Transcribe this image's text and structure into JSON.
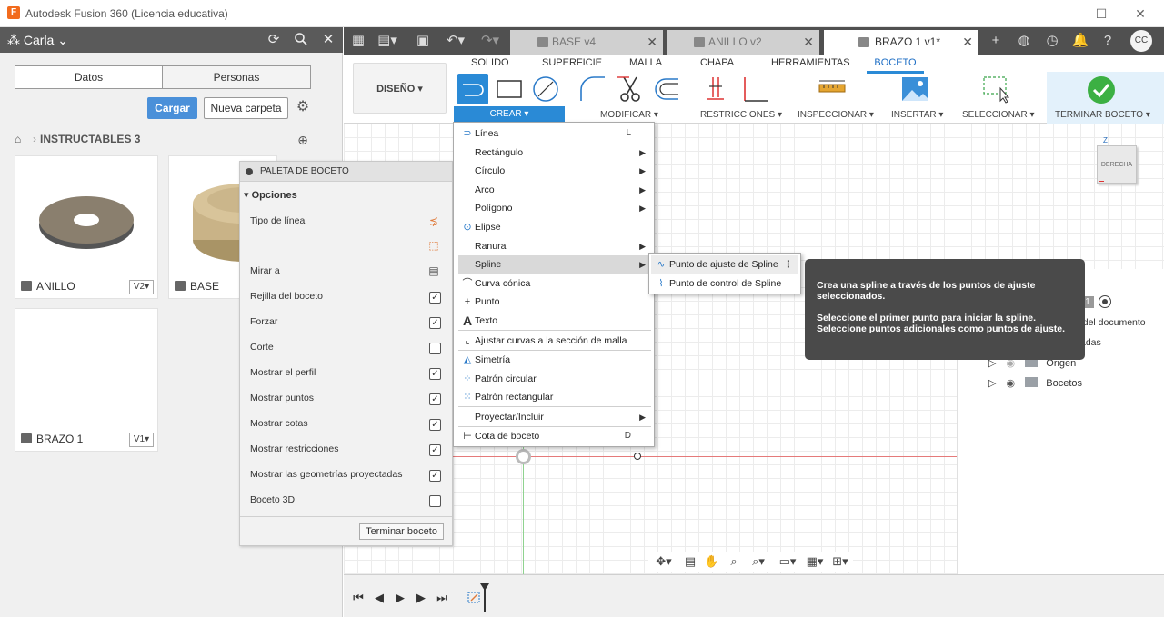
{
  "titlebar": {
    "app_icon": "F",
    "title": "Autodesk Fusion 360 (Licencia educativa)",
    "minimize": "—",
    "maximize": "☐",
    "close": "✕"
  },
  "left_panel": {
    "user": "Carla",
    "tabs": [
      "Datos",
      "Personas"
    ],
    "cargar": "Cargar",
    "nueva_carpeta": "Nueva carpeta",
    "breadcrumb_folder": "INSTRUCTABLES 3",
    "cards": [
      {
        "name": "ANILLO",
        "version": "V2▾"
      },
      {
        "name": "BASE",
        "version": ""
      },
      {
        "name": "BRAZO 1",
        "version": "V1▾"
      }
    ]
  },
  "tabs": [
    {
      "label": "BASE v4"
    },
    {
      "label": "ANILLO v2"
    },
    {
      "label": "BRAZO 1 v1*"
    }
  ],
  "user_badge": "CC",
  "toolbar": {
    "diseno": "DISEÑO ▾",
    "ribbon_tabs": [
      "SOLIDO",
      "SUPERFICIE",
      "MALLA",
      "CHAPA",
      "HERRAMIENTAS",
      "BOCETO"
    ],
    "groups": {
      "crear": "CREAR ▾",
      "modificar": "MODIFICAR ▾",
      "restricciones": "RESTRICCIONES ▾",
      "inspeccionar": "INSPECCIONAR ▾",
      "insertar": "INSERTAR ▾",
      "seleccionar": "SELECCIONAR ▾",
      "terminar": "TERMINAR BOCETO ▾"
    }
  },
  "palette": {
    "title": "PALETA DE BOCETO",
    "section": "▾ Opciones",
    "rows": [
      {
        "label": "Tipo de línea",
        "kind": "icon"
      },
      {
        "label": "",
        "kind": "icon"
      },
      {
        "label": "Mirar a",
        "kind": "icon"
      },
      {
        "label": "Rejilla del boceto",
        "kind": "check",
        "checked": true
      },
      {
        "label": "Forzar",
        "kind": "check",
        "checked": true
      },
      {
        "label": "Corte",
        "kind": "check",
        "checked": false
      },
      {
        "label": "Mostrar el perfil",
        "kind": "check",
        "checked": true
      },
      {
        "label": "Mostrar puntos",
        "kind": "check",
        "checked": true
      },
      {
        "label": "Mostrar cotas",
        "kind": "check",
        "checked": true
      },
      {
        "label": "Mostrar restricciones",
        "kind": "check",
        "checked": true
      },
      {
        "label": "Mostrar las geometrías proyectadas",
        "kind": "check",
        "checked": true
      },
      {
        "label": "Boceto 3D",
        "kind": "check",
        "checked": false
      }
    ],
    "finish": "Terminar boceto"
  },
  "create_menu": {
    "items": [
      {
        "label": "Línea",
        "shortcut": "L",
        "sub": false
      },
      {
        "label": "Rectángulo",
        "shortcut": "",
        "sub": true
      },
      {
        "label": "Círculo",
        "shortcut": "",
        "sub": true
      },
      {
        "label": "Arco",
        "shortcut": "",
        "sub": true
      },
      {
        "label": "Polígono",
        "shortcut": "",
        "sub": true
      },
      {
        "label": "Elipse",
        "shortcut": "",
        "sub": false
      },
      {
        "label": "Ranura",
        "shortcut": "",
        "sub": true
      },
      {
        "label": "Spline",
        "shortcut": "",
        "sub": true
      },
      {
        "label": "Curva cónica",
        "shortcut": "",
        "sub": false
      },
      {
        "label": "Punto",
        "shortcut": "",
        "sub": false
      },
      {
        "label": "Texto",
        "shortcut": "",
        "sub": false
      },
      {
        "label": "Ajustar curvas a la sección de malla",
        "shortcut": "",
        "sub": false
      },
      {
        "label": "Simetría",
        "shortcut": "",
        "sub": false
      },
      {
        "label": "Patrón circular",
        "shortcut": "",
        "sub": false
      },
      {
        "label": "Patrón rectangular",
        "shortcut": "",
        "sub": false
      },
      {
        "label": "Proyectar/Incluir",
        "shortcut": "",
        "sub": true
      },
      {
        "label": "Cota de boceto",
        "shortcut": "D",
        "sub": false
      }
    ]
  },
  "spline_menu": {
    "items": [
      "Punto de ajuste de Spline",
      "Punto de control de Spline"
    ]
  },
  "tooltip": {
    "line1": "Crea una spline a través de los puntos de ajuste seleccionados.",
    "line2": "Seleccione el primer punto para iniciar la spline. Seleccione puntos adicionales como puntos de ajuste."
  },
  "browser": {
    "badge": "1",
    "partial1": "n del documento",
    "partial2": "adas",
    "origen": "Origen",
    "bocetos": "Bocetos"
  },
  "viewcube": {
    "face": "DERECHA",
    "axis_z": "Z"
  }
}
